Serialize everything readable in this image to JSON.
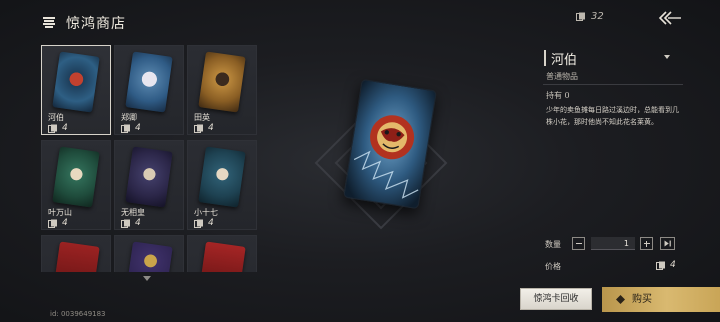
{
  "header": {
    "title": "惊鸿商店",
    "currency_value": "32"
  },
  "grid": {
    "items": [
      {
        "name": "河伯",
        "count": "4",
        "selected": true,
        "art": "red-mask"
      },
      {
        "name": "郑卿",
        "count": "4",
        "selected": false,
        "art": "white-hair"
      },
      {
        "name": "田英",
        "count": "4",
        "selected": false,
        "art": "gold-warrior"
      },
      {
        "name": "叶万山",
        "count": "4",
        "selected": false,
        "art": "green-elder"
      },
      {
        "name": "无相皇",
        "count": "4",
        "selected": false,
        "art": "dark-mask"
      },
      {
        "name": "小十七",
        "count": "4",
        "selected": false,
        "art": "blue-youth"
      },
      {
        "name": "",
        "count": "",
        "selected": false,
        "art": "red-partial"
      },
      {
        "name": "",
        "count": "",
        "selected": false,
        "art": "purple-partial"
      },
      {
        "name": "",
        "count": "",
        "selected": false,
        "art": "red-partial-2"
      }
    ]
  },
  "footer": {
    "user_id": "id: 0039649183"
  },
  "detail": {
    "name": "河伯",
    "type": "普通物品",
    "owned": "持有 0",
    "description": "少年的卖鱼摊每日路过溪边时，总能看到几株小花，那时他尚不知此花名莱黄。",
    "quantity_label": "数量",
    "quantity_value": "1",
    "price_label": "价格",
    "price_value": "4"
  },
  "actions": {
    "recycle_label": "惊鸿卡回收",
    "buy_label": "购买"
  },
  "colors": {
    "accent_gold": "#d9b970",
    "selected_border": "#d7d3ca",
    "background": "#1c1d21"
  },
  "icons": {
    "shop": "shop-icon",
    "card": "card-icon",
    "back": "back-arrow-icon",
    "buy": "diamond-icon"
  }
}
